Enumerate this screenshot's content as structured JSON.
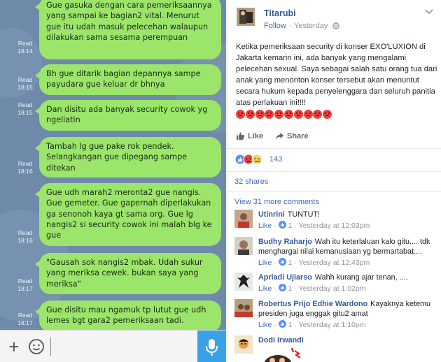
{
  "chat": {
    "messages": [
      {
        "text": "Gue gasuka dengan cara pemeriksaannya yang sampai ke bagian2 vital. Menurut gue itu udah masuk pelecehan walaupun dilakukan sama sesama perempuan",
        "status": "Read",
        "time": "18:14"
      },
      {
        "text": "Bh gue ditarik bagian depannya sampe payudara gue keluar dr bhnya",
        "status": "Read",
        "time": "18:15"
      },
      {
        "text": "Dan disitu ada banyak security cowok yg ngeliatin",
        "status": "Read",
        "time": "18:15"
      },
      {
        "text": "Tambah lg gue pake rok pendek. Selangkangan gue dipegang sampe ditekan",
        "status": "Read",
        "time": "18:16"
      },
      {
        "text": "Gue udh marah2 meronta2 gue nangis. Gue gemeter. Gue gapernah diperlakukan ga senonoh kaya gt sama org. Gue lg nangis2 si security cowok ini malah blg ke gue",
        "status": "Read",
        "time": "18:16"
      },
      {
        "text": "\"Gausah sok nangis2 mbak. Udah sukur yang meriksa cewek. bukan saya yang meriksa\"",
        "status": "Read",
        "time": "18:17"
      },
      {
        "text": "Gue disitu mau ngamuk tp lutut gue udh lemes bgt gara2 pemeriksaan tadi.",
        "status": "Read",
        "time": "18:17"
      }
    ],
    "composer": {
      "value": "",
      "placeholder": ""
    },
    "colors": {
      "bubble": "#9be56b",
      "background": "#6f8aa8",
      "mic": "#3aa1e6"
    }
  },
  "post": {
    "author": "Titarubi",
    "follow_label": "Follow",
    "dot": "·",
    "time": "Yesterday",
    "text": "Ketika pemeriksaan security di konser EXO'LUXION di Jakarta kemarin ini, ada banyak yang mengalami pelecehan sexual. Saya sebagai salah satu orang tua dari anak yang menonton konser tersebut akan menuntut secara hukum kepada penyelenggara dan seluruh panitia atas perlakuan ini!!!!",
    "like_label": "Like",
    "share_label": "Share",
    "reaction_count": "143",
    "shares_label": "32 shares",
    "more_comments_label": "View 31 more comments",
    "colors": {
      "link": "#365899",
      "accent": "#4267b2",
      "angry": "#e9403b"
    }
  },
  "comments": [
    {
      "name": "Utinrini",
      "text": "TUNTUT!",
      "like_label": "Like",
      "likes": "1",
      "time": "Yesterday at 12:03pm"
    },
    {
      "name": "Budhy Raharjo",
      "text": "Wah itu keterlaluan kalo gitu.... tdk menghargai nilai kemanusiaan yg bermartabat....",
      "like_label": "Like",
      "likes": "1",
      "time": "Yesterday at 12:43pm"
    },
    {
      "name": "Apriadi Ujiarso",
      "text": "Wahh kurang ajar tenan, ....",
      "like_label": "Like",
      "likes": "1",
      "time": "Yesterday at 1:02pm"
    },
    {
      "name": "Robertus Prijo Edhie Wardono",
      "text": "Kayaknya ketemu presiden juga enggak gitu2 amat",
      "like_label": "Like",
      "likes": "1",
      "time": "Yesterday at 1:10pm"
    },
    {
      "name": "Dodi Irwandi",
      "text": "",
      "like_label": "",
      "likes": "",
      "time": ""
    }
  ]
}
